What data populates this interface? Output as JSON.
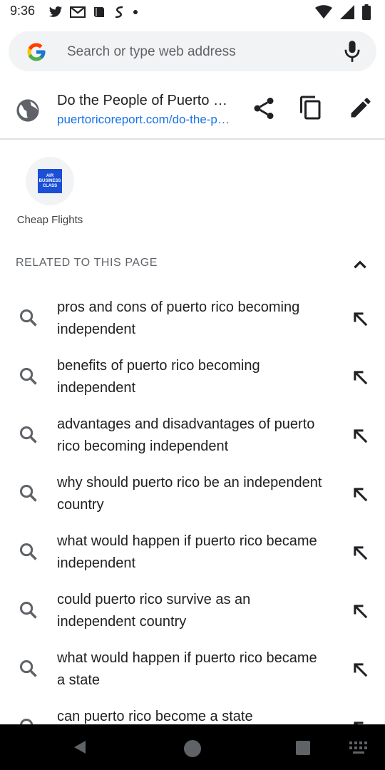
{
  "status_bar": {
    "time": "9:36",
    "left_icons": [
      "twitter-icon",
      "gmail-icon",
      "play-books-icon",
      "stocks-icon",
      "dot-icon"
    ],
    "right_icons": [
      "wifi-icon",
      "signal-icon",
      "battery-icon"
    ]
  },
  "omnibox": {
    "placeholder": "Search or type web address",
    "value": ""
  },
  "current_page": {
    "title": "Do the People of Puerto Rico Want Independence?",
    "url": "puertoricoreport.com/do-the-people-of-puerto-rico-want-independence/"
  },
  "tiles": [
    {
      "label": "Cheap Flights",
      "logo_text": [
        "AIR",
        "BUSINESS",
        "CLASS"
      ]
    }
  ],
  "related_section": {
    "header": "RELATED TO THIS PAGE"
  },
  "suggestions": [
    {
      "line1": "pros and cons of puerto rico becoming",
      "line2": "independent"
    },
    {
      "line1": "benefits of puerto rico becoming",
      "line2": "independent"
    },
    {
      "line1": "advantages and disadvantages of puerto",
      "line2": "rico becoming independent"
    },
    {
      "line1": "why should puerto rico be an independent",
      "line2": "country"
    },
    {
      "line1": "what would happen if puerto rico became",
      "line2": "independent"
    },
    {
      "line1": "could puerto rico survive as an",
      "line2": "independent country"
    },
    {
      "line1": "what would happen if puerto rico became",
      "line2": "a state"
    },
    {
      "line1": "can puerto rico become a state",
      "line2": ""
    }
  ],
  "colors": {
    "accent": "#1a73e8",
    "omnibox_bg": "#f1f3f4",
    "icon_gray": "#5f6368",
    "nav_bar": "#000000"
  }
}
